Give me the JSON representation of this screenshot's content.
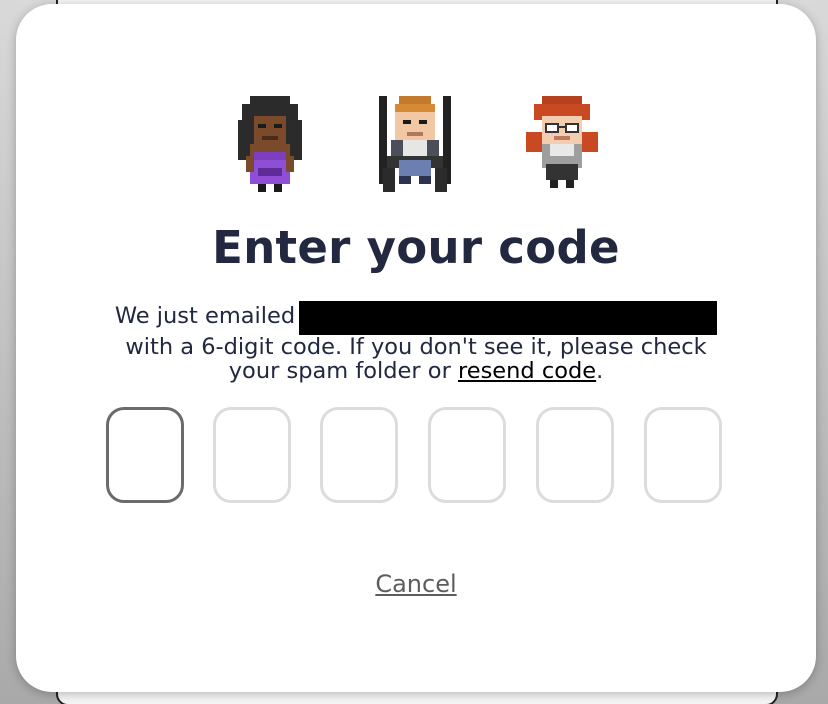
{
  "dialog": {
    "title": "Enter your code",
    "message": {
      "line1_prefix": "We just emailed",
      "line2": "with a 6-digit code. If you don't see it, please check",
      "line3_prefix": "your spam folder or ",
      "resend_link": "resend code",
      "line3_suffix": "."
    },
    "code": {
      "digits": [
        "",
        "",
        "",
        "",
        "",
        ""
      ],
      "active_index": 0
    },
    "cancel_label": "Cancel"
  },
  "avatars": [
    {
      "icon": "pixel-avatar-woman-purple-dress"
    },
    {
      "icon": "pixel-avatar-man-blonde-wheelchair"
    },
    {
      "icon": "pixel-avatar-woman-red-hair-glasses"
    }
  ],
  "colors": {
    "title": "#22283f",
    "inactive_box_border": "#dcdcdc",
    "active_box_border": "#6b6b6b",
    "cancel_text": "#5d5d5d"
  }
}
